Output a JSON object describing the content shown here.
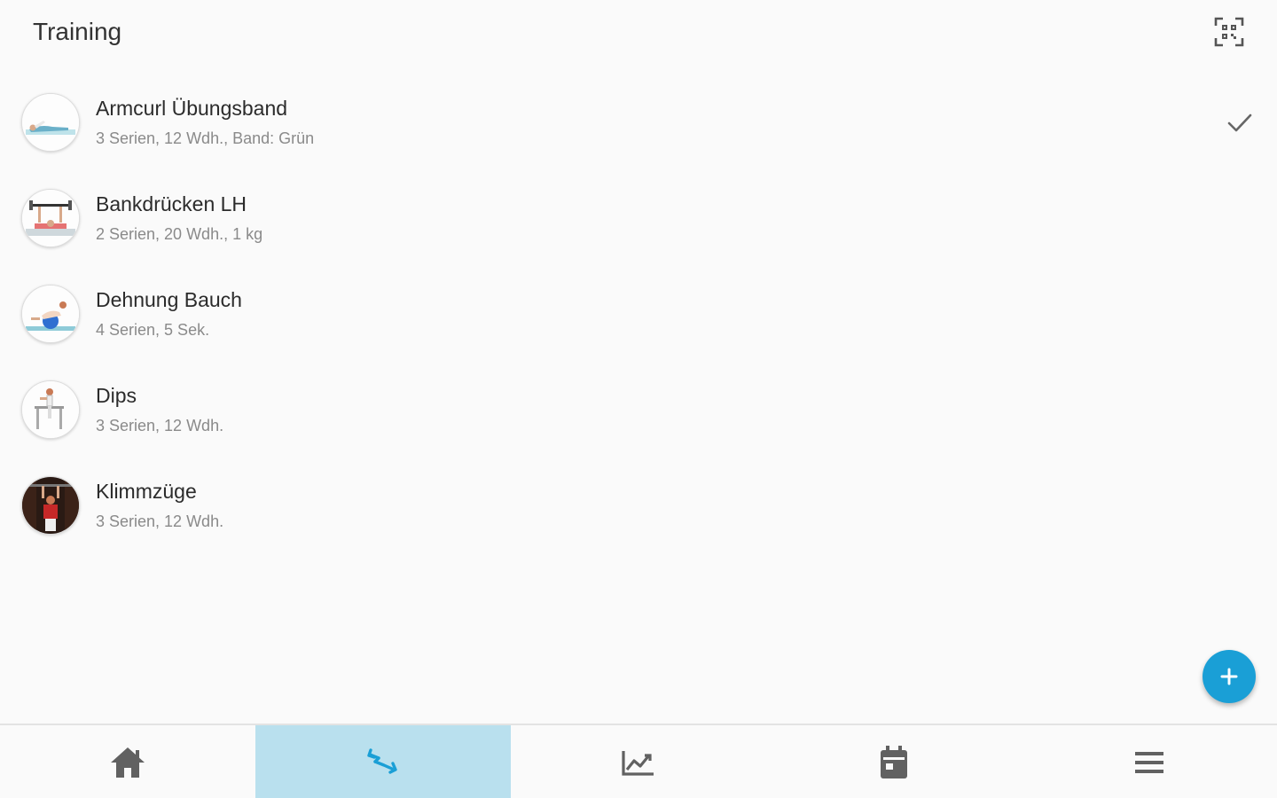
{
  "header": {
    "title": "Training",
    "scan_icon": "qr-scan-icon"
  },
  "exercises": [
    {
      "name": "Armcurl Übungsband",
      "details": "3 Serien, 12 Wdh., Band: Grün",
      "completed": true
    },
    {
      "name": "Bankdrücken LH",
      "details": "2 Serien, 20 Wdh., 1 kg",
      "completed": false
    },
    {
      "name": "Dehnung Bauch",
      "details": "4 Serien, 5 Sek.",
      "completed": false
    },
    {
      "name": "Dips",
      "details": "3 Serien, 12 Wdh.",
      "completed": false
    },
    {
      "name": "Klimmzüge",
      "details": "3 Serien, 12 Wdh.",
      "completed": false
    }
  ],
  "fab": {
    "icon": "plus-icon"
  },
  "bottom_nav": {
    "items": [
      {
        "icon": "home-icon",
        "active": false
      },
      {
        "icon": "exercise-swap-icon",
        "active": true
      },
      {
        "icon": "chart-icon",
        "active": false
      },
      {
        "icon": "calendar-icon",
        "active": false
      },
      {
        "icon": "menu-icon",
        "active": false
      }
    ]
  },
  "colors": {
    "accent": "#1a9fd6",
    "active_nav_bg": "#b9e0ee",
    "background": "#fafafa",
    "subtitle_text": "#8a8a8a",
    "icon_gray": "#616161"
  }
}
